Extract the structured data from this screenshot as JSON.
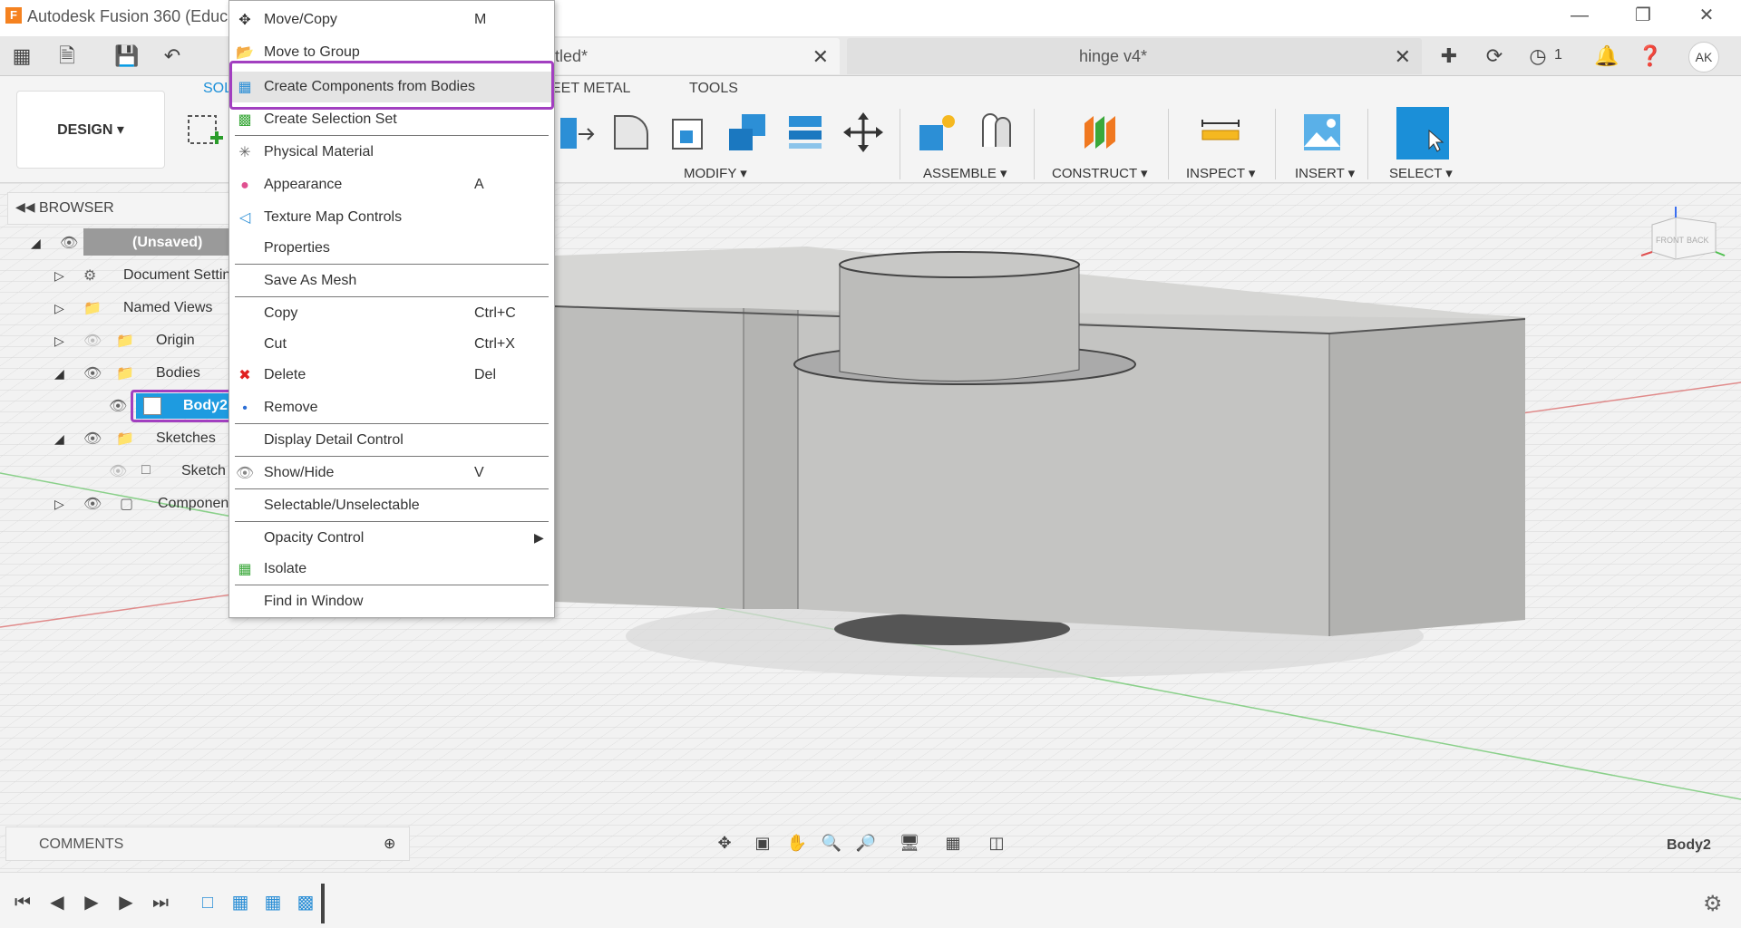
{
  "titlebar": {
    "app_title": "Autodesk Fusion 360 (Educa",
    "logo_letter": "F"
  },
  "tabs": {
    "active_label": "tled*",
    "second_label": "hinge v4*",
    "job_count": "1",
    "user_initials": "AK"
  },
  "ribbon": {
    "design_label": "DESIGN",
    "tabs": [
      "SOL",
      "EET METAL",
      "TOOLS"
    ],
    "groups": [
      "MODIFY",
      "ASSEMBLE",
      "CONSTRUCT",
      "INSPECT",
      "INSERT",
      "SELECT"
    ]
  },
  "browser": {
    "title": "BROWSER",
    "items": [
      {
        "label": "(Unsaved)"
      },
      {
        "label": "Document Settin"
      },
      {
        "label": "Named Views"
      },
      {
        "label": "Origin"
      },
      {
        "label": "Bodies"
      },
      {
        "label": "Body2"
      },
      {
        "label": "Sketches"
      },
      {
        "label": "Sketch"
      },
      {
        "label": "Componen"
      }
    ]
  },
  "context_menu": {
    "items": [
      {
        "label": "Move/Copy",
        "shortcut": "M",
        "icon": "move-icon"
      },
      {
        "label": "Move to Group",
        "shortcut": "",
        "icon": "group-icon"
      },
      {
        "label": "Create Components from Bodies",
        "shortcut": "",
        "icon": "component-icon"
      },
      {
        "label": "Create Selection Set",
        "shortcut": "",
        "icon": "selection-set-icon"
      },
      {
        "label": "Physical Material",
        "shortcut": "",
        "icon": "material-icon"
      },
      {
        "label": "Appearance",
        "shortcut": "A",
        "icon": "appearance-icon"
      },
      {
        "label": "Texture Map Controls",
        "shortcut": "",
        "icon": "texture-icon"
      },
      {
        "label": "Properties",
        "shortcut": "",
        "icon": ""
      },
      {
        "label": "Save As Mesh",
        "shortcut": "",
        "icon": ""
      },
      {
        "label": "Copy",
        "shortcut": "Ctrl+C",
        "icon": ""
      },
      {
        "label": "Cut",
        "shortcut": "Ctrl+X",
        "icon": ""
      },
      {
        "label": "Delete",
        "shortcut": "Del",
        "icon": "delete-icon"
      },
      {
        "label": "Remove",
        "shortcut": "",
        "icon": "remove-icon"
      },
      {
        "label": "Display Detail Control",
        "shortcut": "",
        "icon": ""
      },
      {
        "label": "Show/Hide",
        "shortcut": "V",
        "icon": "eye-icon"
      },
      {
        "label": "Selectable/Unselectable",
        "shortcut": "",
        "icon": ""
      },
      {
        "label": "Opacity Control",
        "shortcut": "",
        "icon": ""
      },
      {
        "label": "Isolate",
        "shortcut": "",
        "icon": "isolate-icon"
      },
      {
        "label": "Find in Window",
        "shortcut": "",
        "icon": ""
      }
    ]
  },
  "viewcube": {
    "front": "FRONT",
    "back": "BACK"
  },
  "comments": {
    "label": "COMMENTS"
  },
  "status": {
    "selection": "Body2"
  },
  "colors": {
    "accent": "#1b8fd8",
    "highlight": "#a23fc0",
    "body": "#c8c8c6",
    "selection_bg": "#1e9be0"
  }
}
